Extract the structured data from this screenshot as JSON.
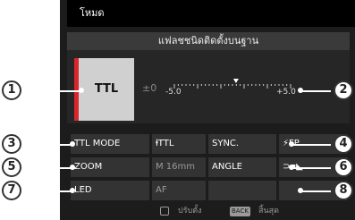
{
  "mode_label": "โหมด",
  "panel_title": "แฟลชชนิดติดตั้งบนฐาน",
  "flash_mode": "TTL",
  "compensation": "±0",
  "scale": {
    "min": "-5.0",
    "max": "+5.0",
    "current_value": 0.3,
    "range": [
      -5.0,
      5.0
    ]
  },
  "settings": {
    "ttl_mode_label": "TTL MODE",
    "ttl_mode_value": "ⱡTTL",
    "sync_label": "SYNC.",
    "sync_value": "⚡FP",
    "zoom_label": "ZOOM",
    "zoom_value": "M 16mm",
    "angle_label": "ANGLE",
    "angle_value": "⊃▪◣",
    "led_label": "LED",
    "led_value": "AF"
  },
  "footer": {
    "adjust_label": "ปรับตั้ง",
    "back_key": "BACK",
    "end_label": "สิ้นสุด"
  },
  "callouts": [
    "1",
    "2",
    "3",
    "4",
    "5",
    "6",
    "7",
    "8"
  ],
  "colors": {
    "accent_red": "#d8262c",
    "screen_bg": "#1c1c1c",
    "selected_bg": "#d0d0d0"
  }
}
